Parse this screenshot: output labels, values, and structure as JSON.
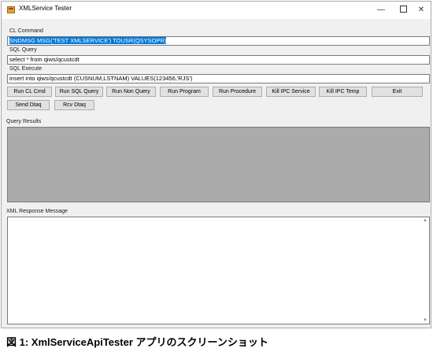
{
  "window": {
    "title": "XMLService Tester",
    "minimize": "—",
    "close": "✕"
  },
  "cl_command": {
    "label": "CL Command",
    "value": "SNDMSG MSG('TEST XMLSERVICE') TOUSR(QSYSOPR)"
  },
  "sql_query": {
    "label": "SQL Query",
    "value": "select * from qiws/qcustcdt"
  },
  "sql_execute": {
    "label": "SQL Execute",
    "value": "insert into qiws/qcustcdt  (CUSNUM,LSTNAM) VALUES(123456,'RJS')"
  },
  "buttons": {
    "run_cl_cmd": "Run CL Cmd",
    "run_sql_query": "Run SQL Query",
    "run_non_query": "Run Non Query",
    "run_program": "Run Program",
    "run_procedure": "Run Procedure",
    "kill_ipc_service": "Kill IPC Service",
    "kill_ipc_temp": "Kill IPC Temp",
    "exit": "Exit",
    "send_dtaq": "Send Dtaq",
    "rcv_dtaq": "Rcv Dtaq"
  },
  "query_results": {
    "label": "Query Results"
  },
  "xml_response": {
    "label": "XML Response Message"
  },
  "caption": "図 1: XmlServiceApiTester アプリのスクリーンショット",
  "colors": {
    "selection": "#0078d7",
    "results_background": "#ababab",
    "window_background": "#f0f0f0"
  }
}
